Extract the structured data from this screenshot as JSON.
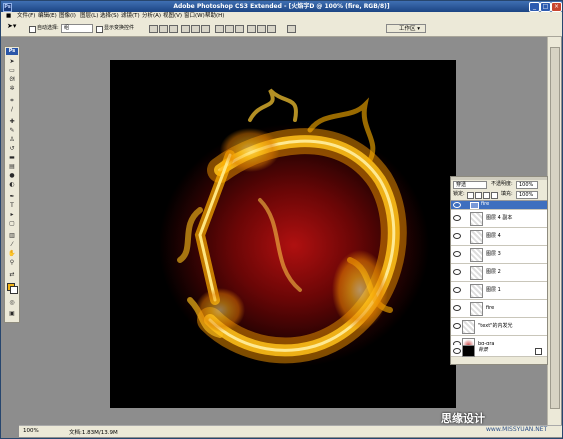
{
  "window": {
    "title": "Adobe Photoshop CS3 Extended - [火焰字D @ 100% (fire, RGB/8)]",
    "app_icon": "Ps"
  },
  "menus": [
    "文件(F)",
    "编辑(E)",
    "图像(I)",
    "图层(L)",
    "选择(S)",
    "滤镜(T)",
    "分析(A)",
    "视图(V)",
    "窗口(W)",
    "帮助(H)"
  ],
  "options_bar": {
    "auto_select_label": "自动选择:",
    "auto_select_value": "组",
    "show_transform_label": "显示变换控件",
    "workspace_label": "工作区"
  },
  "toolbox": {
    "header": "Ps",
    "foreground_color": "#f3b417",
    "background_color": "#ffffff"
  },
  "status": {
    "zoom": "100%",
    "doc_size": "文档:1.83M/13.9M"
  },
  "layers_panel": {
    "blend_mode": "穿透",
    "opacity_label": "不透明度:",
    "opacity_value": "100%",
    "lock_label": "锁定:",
    "fill_label": "填充:",
    "fill_value": "100%",
    "layers": [
      {
        "name": "fire",
        "type": "group",
        "active": true
      },
      {
        "name": "图层 4 副本",
        "type": "layer"
      },
      {
        "name": "图层 4",
        "type": "layer"
      },
      {
        "name": "图层 3",
        "type": "layer"
      },
      {
        "name": "图层 2",
        "type": "layer"
      },
      {
        "name": "图层 1",
        "type": "layer"
      },
      {
        "name": "fire",
        "type": "layer"
      },
      {
        "name": "\"text\"的内发光",
        "type": "layer"
      },
      {
        "name": "bg-gra",
        "type": "gradient"
      },
      {
        "name": "背景",
        "type": "background",
        "locked": true
      }
    ]
  },
  "watermark": {
    "text": "思缘设计",
    "site": "www.MISSYUAN.NET"
  }
}
